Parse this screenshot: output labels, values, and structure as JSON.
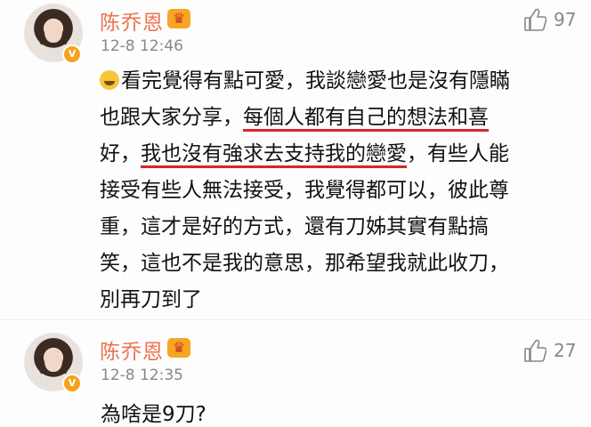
{
  "comments": [
    {
      "username": "陈乔恩",
      "time": "12-8 12:46",
      "likes": "97",
      "lines": [
        "看完覺得有點可愛，我談戀愛也是沒有隱瞞",
        "也跟大家分享，",
        "每個人都有自己的想法和喜",
        "好，",
        "我也沒有強求去支持我的戀愛",
        "，有些人能",
        "接受有些人無法接受，我覺得都可以，彼此尊",
        "重，這才是好的方式，還有刀姊其實有點搞",
        "笑，這也不是我的意思，那希望我就此收刀，",
        "別再刀到了"
      ],
      "emoji_icon": "laughing-tears-emoji",
      "underline_color": "#d8242c"
    },
    {
      "username": "陈乔恩",
      "time": "12-8 12:35",
      "likes": "27",
      "text": "為啥是9刀?"
    }
  ],
  "icons": {
    "verified_badge": "V",
    "crown": "♛",
    "like": "thumbs-up-icon"
  },
  "colors": {
    "username": "#eb7350",
    "timestamp": "#888888",
    "body_text": "#111111",
    "underline": "#d8242c",
    "verified": "#f7a21b"
  }
}
